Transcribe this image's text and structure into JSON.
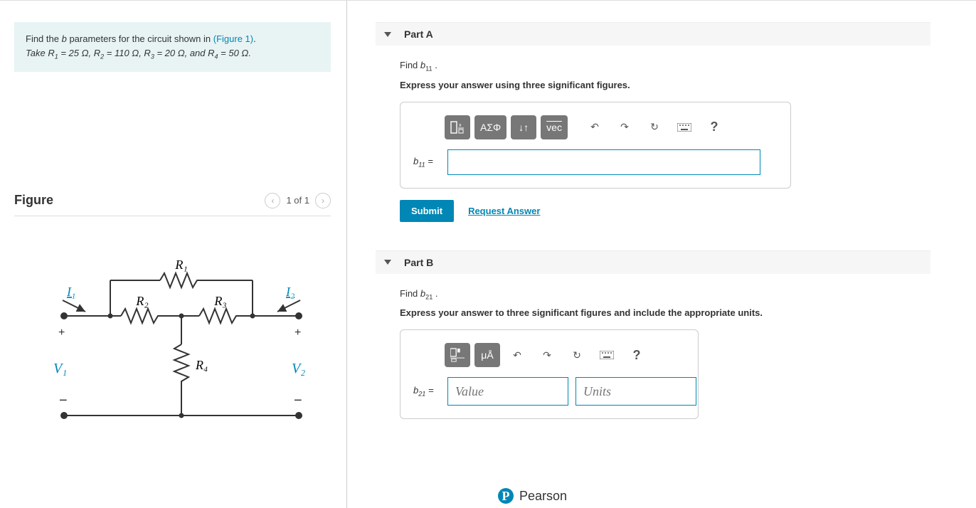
{
  "problem": {
    "line1a": "Find the ",
    "b_ital": "b",
    "line1b": " parameters for the circuit shown in ",
    "figlink": "(Figure 1)",
    "line1c": ".",
    "line2": "Take R₁ = 25 Ω, R₂ = 110 Ω, R₃ = 20 Ω, and R₄ = 50 Ω."
  },
  "figure": {
    "title": "Figure",
    "page": "1 of 1",
    "labels": {
      "R1": "R₁",
      "R2": "R₂",
      "R3": "R₃",
      "R4": "R₄",
      "I1": "I₁",
      "I2": "I₂",
      "V1": "V₁",
      "V2": "V₂"
    }
  },
  "partA": {
    "title": "Part A",
    "find": "Find b₁₁ .",
    "express": "Express your answer using three significant figures.",
    "label": "b₁₁ =",
    "toolbar": {
      "greek": "ΑΣΦ",
      "updown": "↓↑",
      "vec": "vec",
      "help": "?"
    },
    "submit": "Submit",
    "request": "Request Answer"
  },
  "partB": {
    "title": "Part B",
    "find": "Find b₂₁ .",
    "express": "Express your answer to three significant figures and include the appropriate units.",
    "label": "b₂₁ =",
    "toolbar": {
      "mu": "μÅ",
      "help": "?"
    },
    "value_placeholder": "Value",
    "units_placeholder": "Units"
  },
  "footer": {
    "brand": "Pearson",
    "logo": "P"
  }
}
